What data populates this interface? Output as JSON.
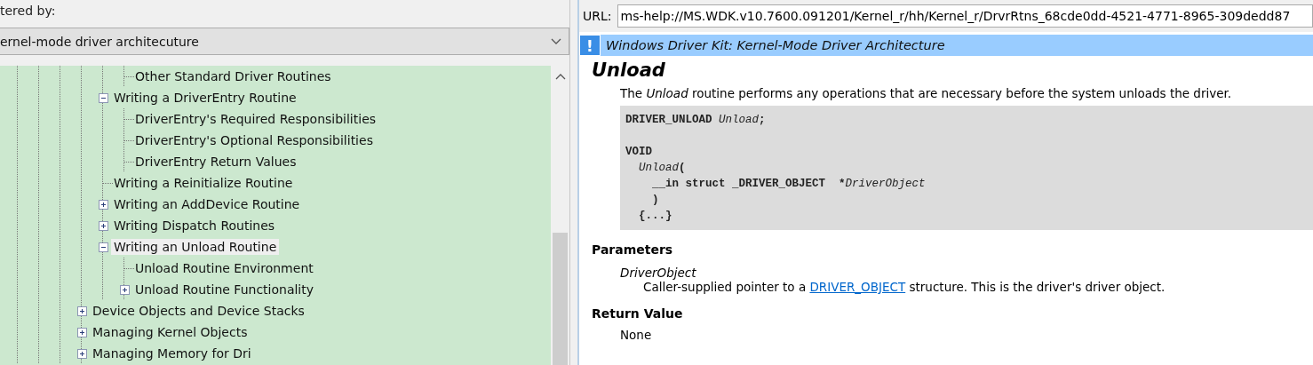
{
  "filter": {
    "label": "tered by:",
    "value": "ernel-mode driver architecuture"
  },
  "tree": {
    "items": [
      {
        "children": [
          {
            "children": [
              {
                "label": "Other Standard Driver Routines",
                "selected": false
              }
            ]
          },
          {
            "label": "Writing a DriverEntry Routine",
            "selected": false,
            "expanded": true,
            "children": [
              {
                "label": "DriverEntry's Required Responsibilities",
                "selected": false
              },
              {
                "label": "DriverEntry's Optional Responsibilities",
                "selected": false
              },
              {
                "label": "DriverEntry Return Values",
                "selected": false
              }
            ]
          },
          {
            "label": "Writing a Reinitialize Routine",
            "selected": false
          },
          {
            "label": "Writing an AddDevice Routine",
            "selected": false,
            "expanded": false
          },
          {
            "label": "Writing Dispatch Routines",
            "selected": false,
            "expanded": false
          },
          {
            "label": "Writing an Unload Routine",
            "selected": true,
            "expanded": true,
            "children": [
              {
                "label": "Unload Routine Environment",
                "selected": false
              },
              {
                "label": "Unload Routine Functionality",
                "selected": false,
                "expanded": false
              }
            ]
          }
        ]
      },
      {
        "label": "Device Objects and Device Stacks",
        "selected": false,
        "expanded": false
      },
      {
        "label": "Managing Kernel Objects",
        "selected": false,
        "expanded": false
      },
      {
        "label": "Managing Memory for Dri",
        "selected": false,
        "expanded": false
      }
    ]
  },
  "url_bar": {
    "label": "URL:",
    "value": "ms-help://MS.WDK.v10.7600.091201/Kernel_r/hh/Kernel_r/DrvrRtns_68cde0dd-4521-4771-8965-309dedd87"
  },
  "doc": {
    "banner_icon": "!",
    "banner": "Windows Driver Kit: Kernel-Mode Driver Architecture",
    "title": "Unload",
    "intro": "The *Unload* routine performs any operations that are necessary before the system unloads the driver.",
    "code": [
      {
        "parts": [
          {
            "text": "DRIVER_UNLOAD ",
            "kind": "plain"
          },
          {
            "text": "Unload",
            "kind": "italic"
          },
          {
            "text": ";",
            "kind": "plain"
          }
        ]
      },
      {
        "gap_before": true,
        "parts": [
          {
            "text": "VOID",
            "kind": "plain"
          }
        ]
      },
      {
        "parts": [
          {
            "text": "  Unload",
            "kind": "italic"
          },
          {
            "text": "(",
            "kind": "plain"
          }
        ]
      },
      {
        "parts": [
          {
            "text": "    __in struct _DRIVER_OBJECT  *",
            "kind": "plain"
          },
          {
            "text": "DriverObject",
            "kind": "italic"
          }
        ]
      },
      {
        "parts": [
          {
            "text": "    )",
            "kind": "plain"
          }
        ]
      },
      {
        "parts": [
          {
            "text": "  {...}",
            "kind": "plain"
          }
        ]
      }
    ],
    "sections": [
      {
        "heading": "Parameters",
        "term": "DriverObject",
        "text_before": "Caller-supplied pointer to a",
        "link": "DRIVER_OBJECT",
        "text_after": "structure. This is the driver's driver object."
      },
      {
        "heading": "Return Value",
        "body": "None"
      }
    ]
  }
}
